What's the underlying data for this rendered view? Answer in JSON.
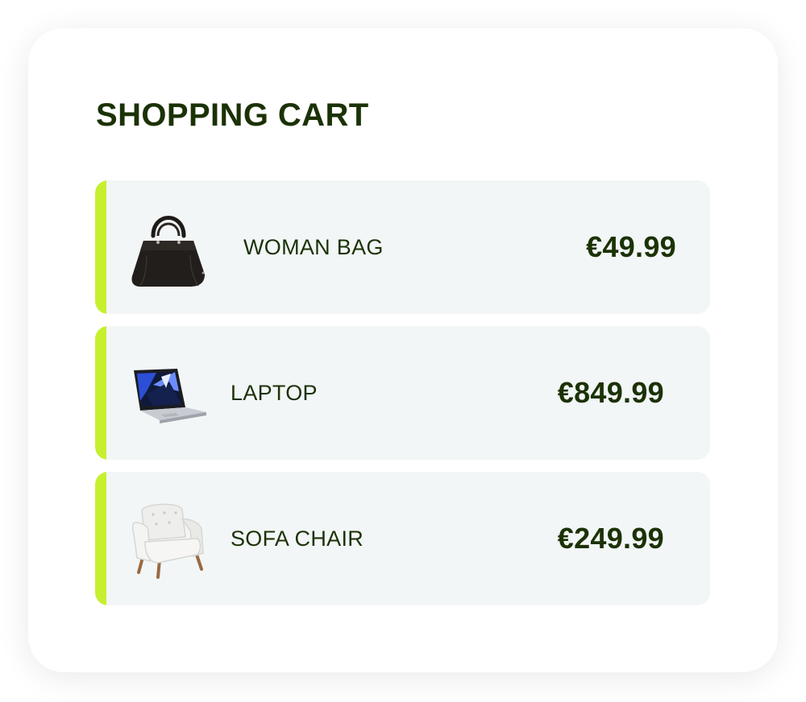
{
  "cart": {
    "title": "SHOPPING CART",
    "accent_color": "#c6f02f",
    "text_color": "#1b3205",
    "items": [
      {
        "name": "WOMAN BAG",
        "price": "€49.99",
        "icon": "handbag-icon"
      },
      {
        "name": "LAPTOP",
        "price": "€849.99",
        "icon": "laptop-icon"
      },
      {
        "name": "SOFA CHAIR",
        "price": "€249.99",
        "icon": "armchair-icon"
      }
    ]
  }
}
